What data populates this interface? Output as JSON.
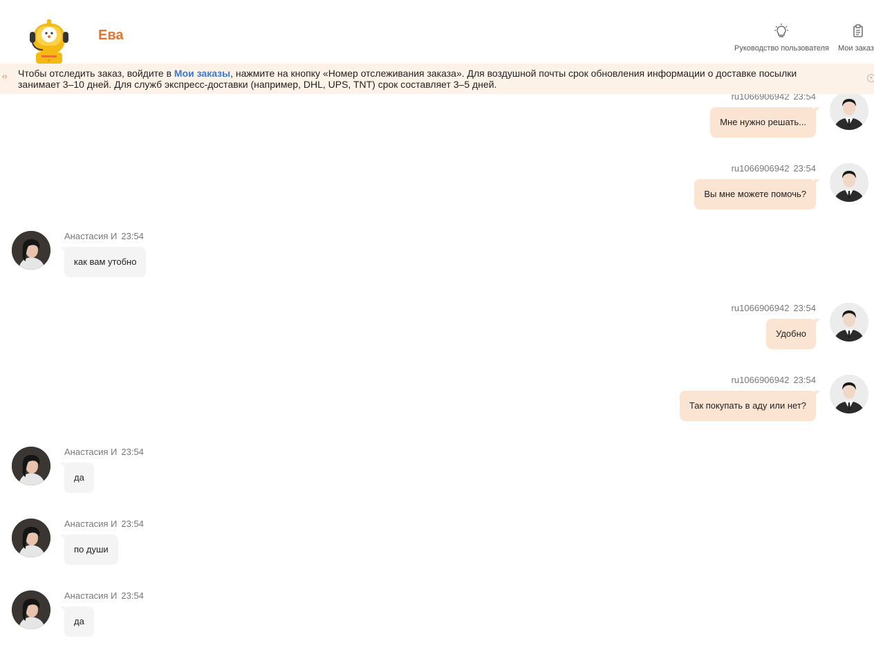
{
  "header": {
    "bot_name": "Ева",
    "guide_label": "Руководство пользователя",
    "orders_label": "Мои заказ"
  },
  "notice": {
    "text_before": "Чтобы отследить заказ, войдите в ",
    "link": "Мои заказы",
    "text_after": ", нажмите на кнопку «Номер отслеживания заказа». Для воздушной почты срок обновления информации о доставке посылки занимает 3–10 дней. Для служб экспресс-доставки (например, DHL, UPS, TNT) срок составляет 3–5 дней."
  },
  "messages": [
    {
      "sender": "ru1066906942",
      "time": "23:54",
      "text": "Мне нужно решать..."
    },
    {
      "sender": "ru1066906942",
      "time": "23:54",
      "text": "Вы мне можете помочь?"
    },
    {
      "sender": "Анастасия И",
      "time": "23:54",
      "text": "как вам утобно"
    },
    {
      "sender": "ru1066906942",
      "time": "23:54",
      "text": "Удобно"
    },
    {
      "sender": "ru1066906942",
      "time": "23:54",
      "text": "Так покупать в аду или нет?"
    },
    {
      "sender": "Анастасия И",
      "time": "23:54",
      "text": "да"
    },
    {
      "sender": "Анастасия И",
      "time": "23:54",
      "text": "по души"
    },
    {
      "sender": "Анастасия И",
      "time": "23:54",
      "text": "да"
    }
  ],
  "colors": {
    "accent": "#e8722a",
    "link": "#3a78d4",
    "notice_bg": "#fdf2e8",
    "outgoing_bubble": "#fbe5d2",
    "incoming_bubble": "#f4f4f4"
  }
}
